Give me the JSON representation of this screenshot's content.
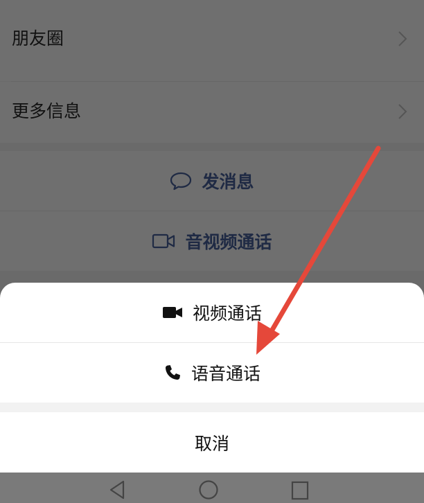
{
  "profile": {
    "moments_label": "朋友圈",
    "more_info_label": "更多信息",
    "send_message_label": "发消息",
    "av_call_label": "音视频通话"
  },
  "sheet": {
    "video_call_label": "视频通话",
    "voice_call_label": "语音通话",
    "cancel_label": "取消"
  },
  "colors": {
    "overlay": "#6f6f6f",
    "sheet_bg": "#ffffff",
    "action_text": "#1f2a44",
    "annotation_arrow": "#e5483a"
  },
  "icons": {
    "moments_chevron": "chevron-right-icon",
    "more_info_chevron": "chevron-right-icon",
    "send_message": "chat-bubble-icon",
    "av_call": "video-camera-outline-icon",
    "video_call": "video-camera-filled-icon",
    "voice_call": "phone-icon",
    "nav_back": "back-triangle-icon",
    "nav_home": "home-circle-icon",
    "nav_recents": "recents-square-icon"
  }
}
